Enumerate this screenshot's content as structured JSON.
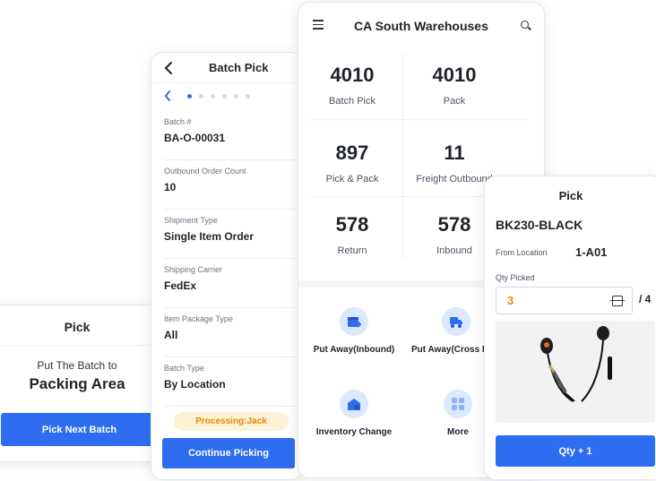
{
  "left_pick": {
    "title": "Pick",
    "instruction": "Put The Batch to",
    "destination": "Packing Area",
    "button": "Pick Next Batch"
  },
  "batch_pick": {
    "back_icon": "chevron-left-icon",
    "title": "Batch Pick",
    "pager": {
      "pages": 7,
      "current": 1
    },
    "fields": [
      {
        "label": "Batch #",
        "value": "BA-O-00031"
      },
      {
        "label": "Outbound Order Count",
        "value": "10"
      },
      {
        "label": "Shipment Type",
        "value": "Single Item Order"
      },
      {
        "label": "Shipping Carrier",
        "value": "FedEx"
      },
      {
        "label": "Item Package Type",
        "value": "All"
      },
      {
        "label": "Batch Type",
        "value": "By Location"
      }
    ],
    "status": "Processing:Jack",
    "button": "Continue Picking"
  },
  "warehouse": {
    "title": "CA South Warehouses",
    "stats": [
      {
        "value": "4010",
        "label": "Batch Pick"
      },
      {
        "value": "4010",
        "label": "Pack"
      },
      {
        "value": "897",
        "label": "Pick & Pack"
      },
      {
        "value": "11",
        "label": "Freight Outbound"
      },
      {
        "value": "578",
        "label": "Return"
      },
      {
        "value": "578",
        "label": "Inbound"
      }
    ],
    "actions": [
      {
        "label": "Put Away(Inbound)",
        "icon": "put-away-icon"
      },
      {
        "label": "Put Away(Cross Dock)",
        "icon": "truck-icon"
      },
      {
        "label": "Inventory Change",
        "icon": "warehouse-icon"
      },
      {
        "label": "More",
        "icon": "grid-icon"
      }
    ]
  },
  "right_pick": {
    "title": "Pick",
    "sku": "BK230-BLACK",
    "location_label": "From Location",
    "location": "1-A01",
    "qty_label": "Qty Picked",
    "qty": "3",
    "qty_total": "/ 4",
    "product_image": "earphones-image",
    "button": "Qty + 1"
  },
  "colors": {
    "primary": "#2f6df0",
    "status_bg": "#fdf1d6",
    "status_text": "#e58a00",
    "icon_bg": "#dce8fd"
  }
}
